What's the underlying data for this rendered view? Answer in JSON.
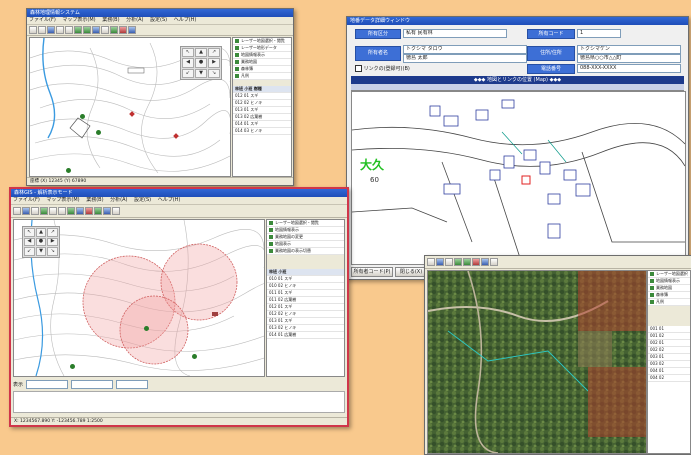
{
  "win1": {
    "title": "森林地理情報システム",
    "menu": [
      "ファイル(F)",
      "マップ表示(M)",
      "業務(B)",
      "分析(A)",
      "設定(S)",
      "ヘルプ(H)"
    ],
    "side_top": [
      "レーザー地図選択・閲覧",
      "レーザー地形データ",
      "地図情報表示",
      "業務地図",
      "森林簿",
      "凡例"
    ],
    "side_list": [
      "林班 小班 樹種",
      "012 01 スギ",
      "012 02 ヒノキ",
      "013 01 スギ",
      "013 02 広葉樹",
      "014 01 スギ",
      "014 03 ヒノキ"
    ],
    "status": "座標 (X) 12345 (Y) 67890"
  },
  "win2": {
    "header_title": "地番データ詳細ウィンドウ",
    "label_a": "所有区分",
    "value_a": "私有 民有林",
    "label_b": "所有コード",
    "value_b": "1",
    "label_owner": "所有者名",
    "owner_kana": "トクシマ タロウ",
    "owner_name": "徳島 太郎",
    "label_address": "住所/住所",
    "address_kana": "トクシマケン",
    "address": "徳島県○○市△△町",
    "checkbox_label": "リンクの(登録可)(B)",
    "label_phone": "電話番号",
    "phone": "088-XXX-XXXX",
    "banner": "◆◆◆ 地図とリンクの位置 (Map) ◆◆◆",
    "place_label": "大久",
    "number_label": "60",
    "footer_btn1": "所有者コード(P)",
    "footer_btn2": "閉じる(X)"
  },
  "win3": {
    "title": "森林GIS - 解析表示モード",
    "menu": [
      "ファイル(F)",
      "マップ表示(M)",
      "業務(B)",
      "分析(A)",
      "設定(S)",
      "ヘルプ(H)"
    ],
    "side_top": [
      "レーザー地図選択・閲覧",
      "地図情報表示",
      "業務地図の変更",
      "地図表示",
      "業務地図の表示切替"
    ],
    "side_list": [
      "林班 小班",
      "010 01 スギ",
      "010 02 ヒノキ",
      "011 01 スギ",
      "011 02 広葉樹",
      "012 01 スギ",
      "012 02 ヒノキ",
      "013 01 スギ",
      "013 02 ヒノキ",
      "014 01 広葉樹"
    ],
    "bottom_label": "表示",
    "status": "X: 1234567.890  Y: -123456.789  1:2500"
  },
  "win4": {
    "side_top": [
      "レーザー地図選択",
      "地図情報表示",
      "業務地図",
      "森林簿",
      "凡例"
    ],
    "side_list": [
      "001 01",
      "001 02",
      "002 01",
      "002 02",
      "003 01",
      "003 02",
      "004 01",
      "004 02"
    ]
  },
  "colors": {
    "background": "#f9c98d",
    "accent": "#3d6fd6",
    "titlebar": "#1f4db8",
    "buffer_circle": "#f2a0a0",
    "place_label": "#20c020",
    "frame_red": "#d0364a"
  },
  "icons": [
    "arrow-up-icon",
    "arrow-down-icon",
    "arrow-left-icon",
    "arrow-right-icon",
    "zoom-icon",
    "layer-icon"
  ]
}
